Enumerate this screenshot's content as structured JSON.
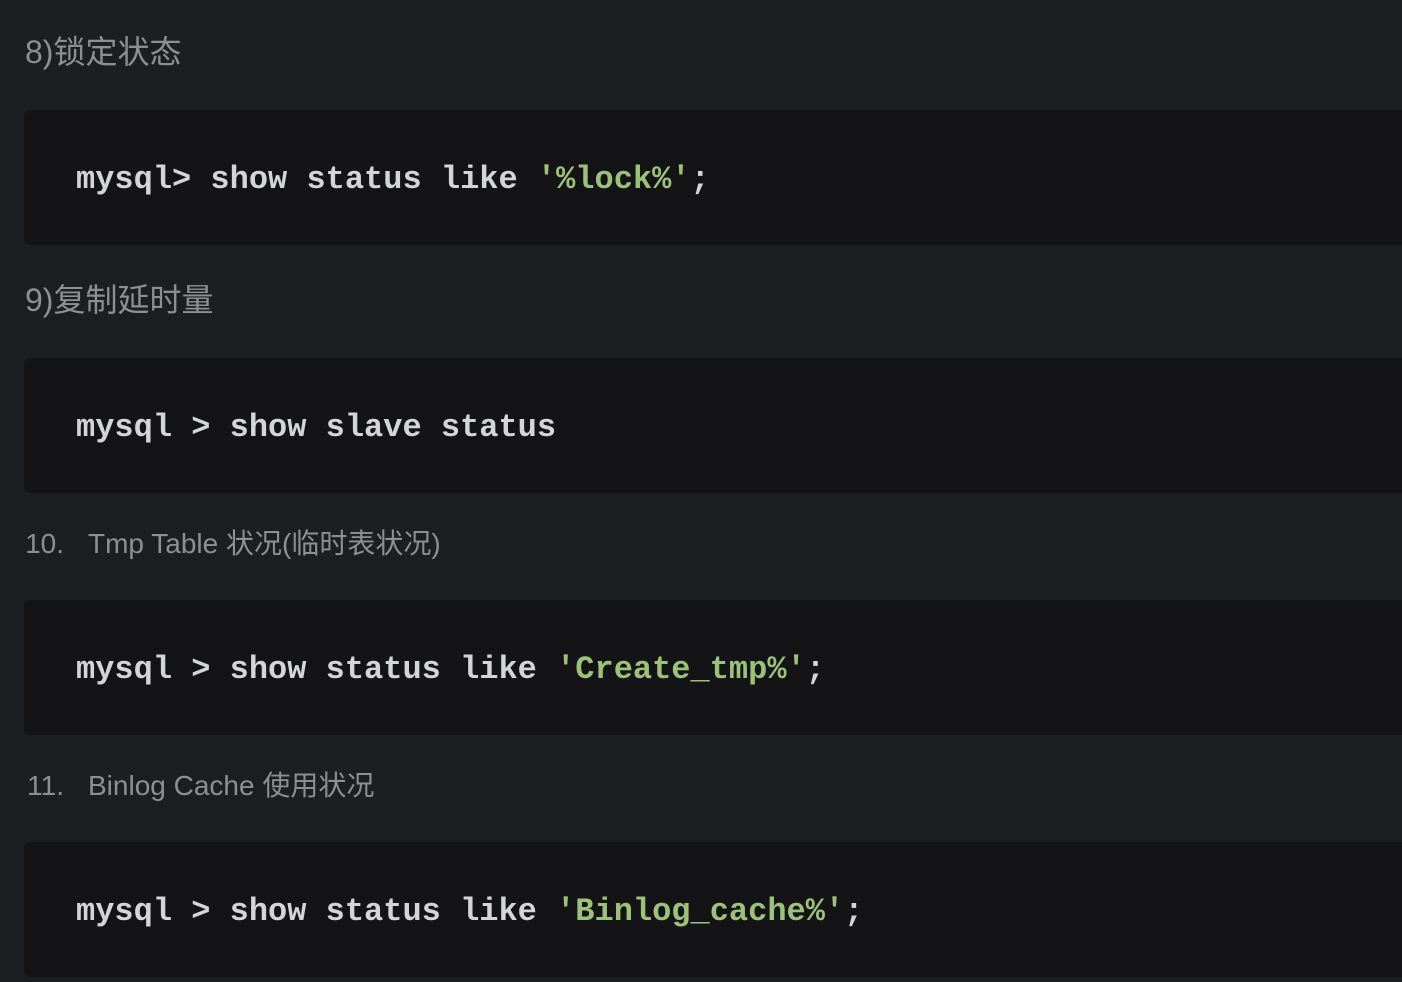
{
  "sections": [
    {
      "heading": "8)锁定状态",
      "code": {
        "prefix": "mysql> show status like ",
        "string": "'%lock%'",
        "suffix": ";"
      }
    },
    {
      "heading": "9)复制延时量",
      "code": {
        "prefix": "mysql > show slave status",
        "string": "",
        "suffix": ""
      }
    },
    {
      "number": "10.",
      "heading": "Tmp Table 状况(临时表状况)",
      "code": {
        "prefix": "mysql > show status like ",
        "string": "'Create_tmp%'",
        "suffix": ";"
      }
    },
    {
      "number": "11.",
      "heading": "Binlog Cache 使用状况",
      "code": {
        "prefix": "mysql > show status like ",
        "string": "'Binlog_cache%'",
        "suffix": ";"
      }
    }
  ],
  "colors": {
    "page_background": "#1d1e21",
    "code_background": "#141416",
    "text_muted": "#8d8f93",
    "code_text": "#d4d5d8",
    "code_string": "#9cc27a"
  }
}
